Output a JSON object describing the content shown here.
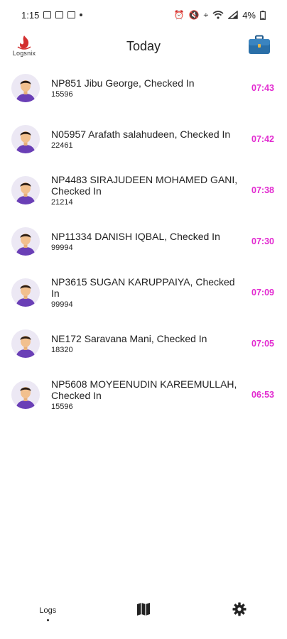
{
  "status_bar": {
    "time": "1:15",
    "battery": "4%"
  },
  "header": {
    "title": "Today",
    "logo_text": "Logsnix",
    "briefcase_icon": "briefcase-icon"
  },
  "logs": [
    {
      "title": "NP851 Jibu George, Checked In",
      "code": "15596",
      "time": "07:43"
    },
    {
      "title": "N05957 Arafath salahudeen, Checked In",
      "code": "22461",
      "time": "07:42"
    },
    {
      "title": "NP4483 SIRAJUDEEN MOHAMED GANI, Checked In",
      "code": "21214",
      "time": "07:38"
    },
    {
      "title": "NP11334 DANISH IQBAL, Checked In",
      "code": "99994",
      "time": "07:30"
    },
    {
      "title": "NP3615 SUGAN KARUPPAIYA, Checked In",
      "code": "99994",
      "time": "07:09"
    },
    {
      "title": "NE172 Saravana Mani, Checked In",
      "code": "18320",
      "time": "07:05"
    },
    {
      "title": "NP5608 MOYEENUDIN KAREEMULLAH, Checked In",
      "code": "15596",
      "time": "06:53"
    }
  ],
  "bottom_nav": {
    "logs_label": "Logs",
    "map_icon": "map-icon",
    "settings_icon": "gear-icon"
  },
  "colors": {
    "time_accent": "#e229d0",
    "avatar_bg": "#ece8f4",
    "avatar_shirt": "#6a3fb6",
    "briefcase": "#2a6fa8",
    "logo_red": "#d32f2f"
  }
}
